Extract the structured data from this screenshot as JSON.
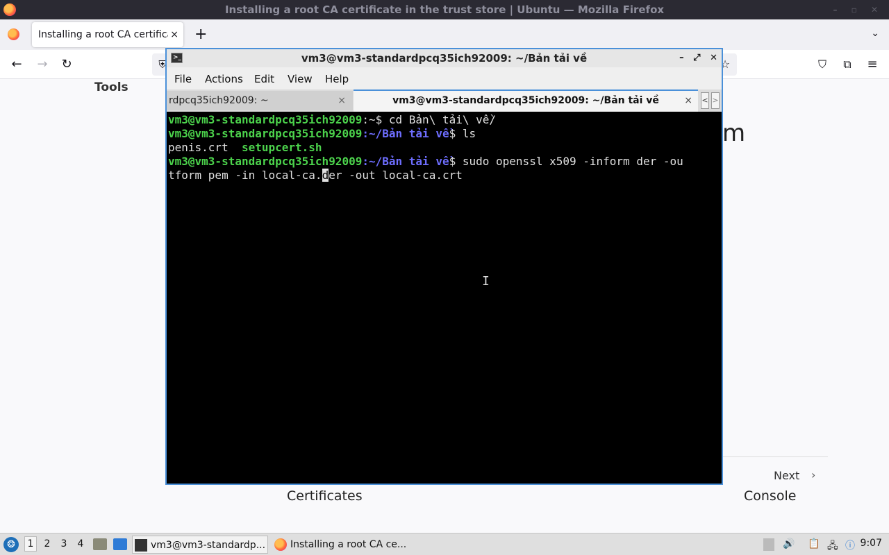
{
  "firefox": {
    "window_title": "Installing a root CA certificate in the trust store | Ubuntu — Mozilla Firefox",
    "tab_title": "Installing a root CA certificat",
    "tab_close": "×",
    "new_tab": "+",
    "tab_list": "⌄",
    "nav": {
      "back": "←",
      "forward": "→",
      "reload": "↻",
      "pocket": "⛉",
      "extensions": "⧉",
      "menu": "≡",
      "shield": "⛨",
      "bookmark": "☆"
    }
  },
  "page": {
    "tools_label": "Tools",
    "heading_tail": "m",
    "next_label": "Next",
    "next_chevron": "›",
    "prev_title": "Certificates",
    "next_title": "Console"
  },
  "terminal": {
    "window_title": "vm3@vm3-standardpcq35ich92009: ~/Bản tải về",
    "icon_glyph": ">_",
    "controls": {
      "minimize": "–",
      "maximize": "⤢",
      "close": "✕"
    },
    "menu": [
      "File",
      "Actions",
      "Edit",
      "View",
      "Help"
    ],
    "tabs": [
      {
        "label": "rdpcq35ich92009: ~",
        "close": "×"
      },
      {
        "label": "vm3@vm3-standardpcq35ich92009: ~/Bản tải về",
        "close": "×"
      }
    ],
    "scroll_left": "<",
    "scroll_right": ">",
    "lines": {
      "l1_user": "vm3@vm3-standardpcq35ich92009",
      "l1_path": ":~",
      "l1_cmd": "$ cd Bản\\ tải\\ về/",
      "l2_user": "vm3@vm3-standardpcq35ich92009",
      "l2_path": ":~/Bản tải về",
      "l2_cmd": "$ ls",
      "l3_file1": "penis.crt  ",
      "l3_file2": "setupcert.sh",
      "l4_user": "vm3@vm3-standardpcq35ich92009",
      "l4_path": ":~/Bản tải về",
      "l4_cmd": "$ sudo openssl x509 -inform der -ou",
      "l5_pre": "tform pem -in local-ca.",
      "l5_cursor": "d",
      "l5_post": "er -out local-ca.crt"
    },
    "ibeam": "I"
  },
  "taskbar": {
    "start_glyph": "❂",
    "workspaces": [
      "1",
      "2",
      "3",
      "4"
    ],
    "tasks": [
      {
        "label": "vm3@vm3-standardp..."
      },
      {
        "label": "Installing a root CA ce..."
      }
    ],
    "tray": {
      "volume": "🔊",
      "clipboard": "📋",
      "network": "🖧",
      "notification": "ⓘ"
    },
    "clock": "9:07"
  }
}
